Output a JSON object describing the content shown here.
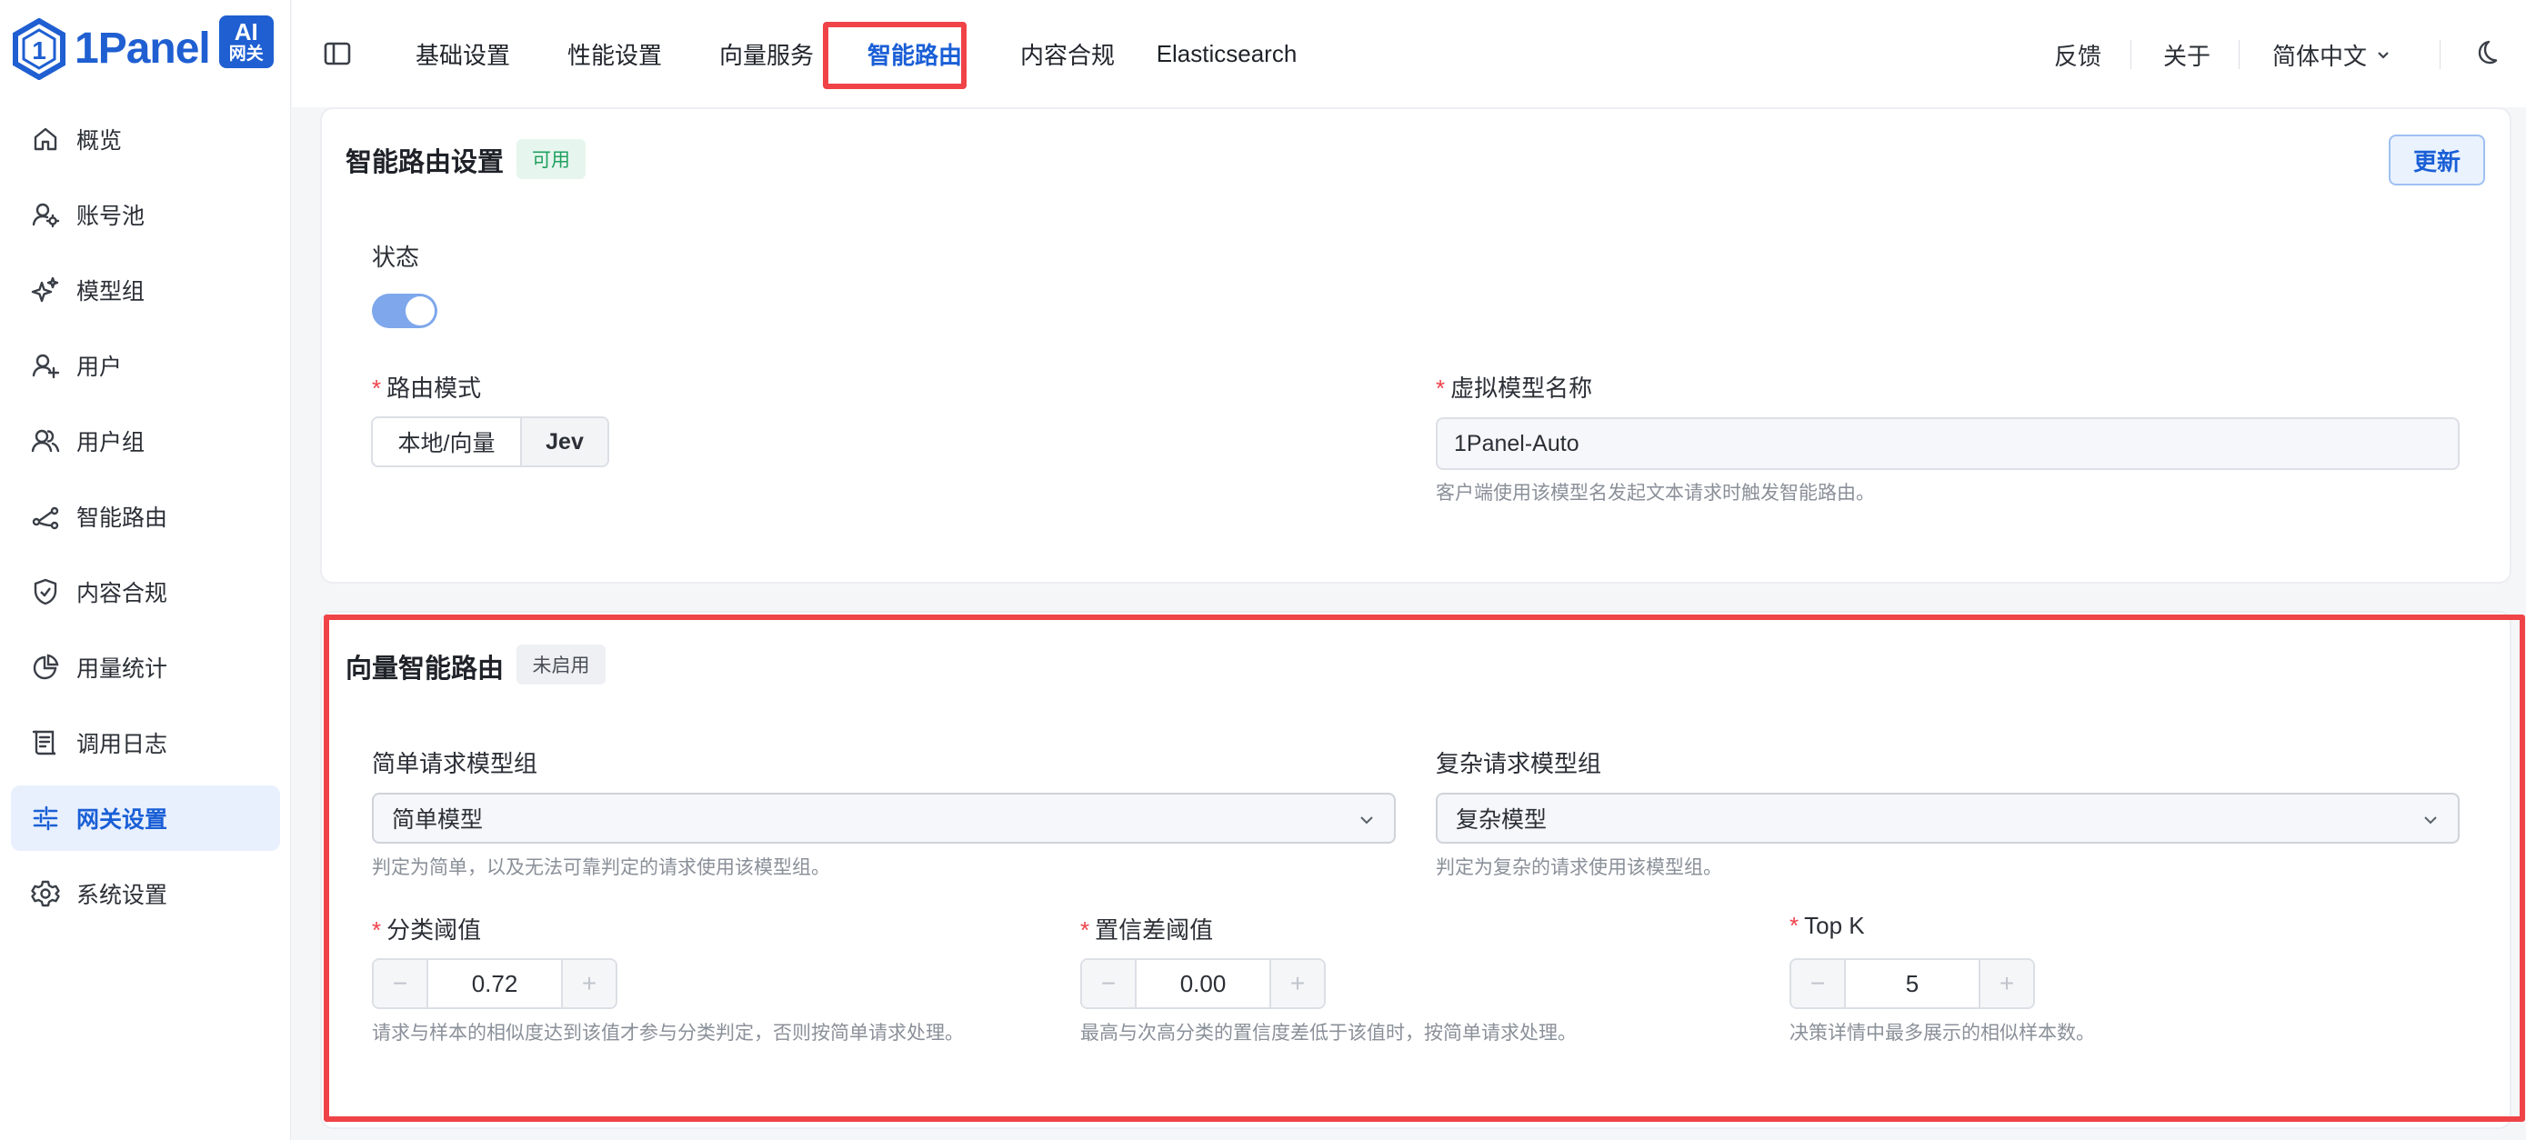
{
  "logo": {
    "text": "1Panel",
    "badge_line1": "AI",
    "badge_line2": "网关"
  },
  "sidebar": {
    "items": [
      {
        "label": "概览",
        "icon": "home-icon"
      },
      {
        "label": "账号池",
        "icon": "account-pool-icon"
      },
      {
        "label": "模型组",
        "icon": "sparkle-icon"
      },
      {
        "label": "用户",
        "icon": "user-add-icon"
      },
      {
        "label": "用户组",
        "icon": "users-icon"
      },
      {
        "label": "智能路由",
        "icon": "route-icon"
      },
      {
        "label": "内容合规",
        "icon": "shield-check-icon"
      },
      {
        "label": "用量统计",
        "icon": "pie-chart-icon"
      },
      {
        "label": "调用日志",
        "icon": "log-scroll-icon"
      },
      {
        "label": "网关设置",
        "icon": "sliders-icon",
        "active": true
      },
      {
        "label": "系统设置",
        "icon": "gear-icon"
      }
    ]
  },
  "topbar": {
    "tabs": [
      {
        "label": "基础设置"
      },
      {
        "label": "性能设置"
      },
      {
        "label": "向量服务"
      },
      {
        "label": "智能路由",
        "active": true
      },
      {
        "label": "内容合规"
      },
      {
        "label": "Elasticsearch"
      }
    ],
    "feedback": "反馈",
    "about": "关于",
    "language": "简体中文"
  },
  "routing_card": {
    "title": "智能路由设置",
    "status_tag": "可用",
    "update_button": "更新",
    "status_label": "状态",
    "status_enabled": true,
    "mode_label": "路由模式",
    "mode_options": [
      "本地/向量",
      "Jev"
    ],
    "mode_selected": "Jev",
    "virtual_model_label": "虚拟模型名称",
    "virtual_model_value": "1Panel-Auto",
    "virtual_model_hint": "客户端使用该模型名发起文本请求时触发智能路由。"
  },
  "vector_card": {
    "title": "向量智能路由",
    "status_tag": "未启用",
    "simple_label": "简单请求模型组",
    "simple_value": "简单模型",
    "simple_hint": "判定为简单，以及无法可靠判定的请求使用该模型组。",
    "complex_label": "复杂请求模型组",
    "complex_value": "复杂模型",
    "complex_hint": "判定为复杂的请求使用该模型组。",
    "threshold_label": "分类阈值",
    "threshold_value": "0.72",
    "threshold_hint": "请求与样本的相似度达到该值才参与分类判定，否则按简单请求处理。",
    "confidence_label": "置信差阈值",
    "confidence_value": "0.00",
    "confidence_hint": "最高与次高分类的置信度差低于该值时，按简单请求处理。",
    "topk_label": "Top K",
    "topk_value": "5",
    "topk_hint": "决策详情中最多展示的相似样本数。"
  },
  "colors": {
    "accent": "#1a5fd6",
    "highlight": "#ef4348",
    "ok": "#20a060"
  }
}
